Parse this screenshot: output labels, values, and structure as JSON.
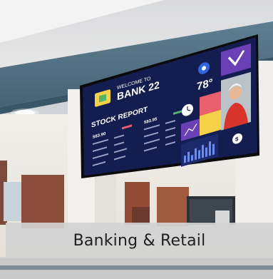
{
  "caption": "Banking & Retail",
  "screen": {
    "welcome": "WELCOME TO",
    "bank_name": "BANK 22",
    "temperature": "78°",
    "stock_heading": "STOCK REPORT",
    "stock_value_1": "583.90",
    "stock_value_2": "583.95"
  },
  "colors": {
    "screen_bg": "#141d4f",
    "accent_yellow": "#f6d047",
    "accent_pink": "#e8606b",
    "accent_purple": "#6b3fb5",
    "caption_bg": "#d2d2d2"
  },
  "icons": {
    "weather": "sun-icon",
    "clock": "clock-icon",
    "badge": "checkmark-badge-icon",
    "money": "dollar-coin-icon",
    "chart": "bar-chart-icon"
  }
}
